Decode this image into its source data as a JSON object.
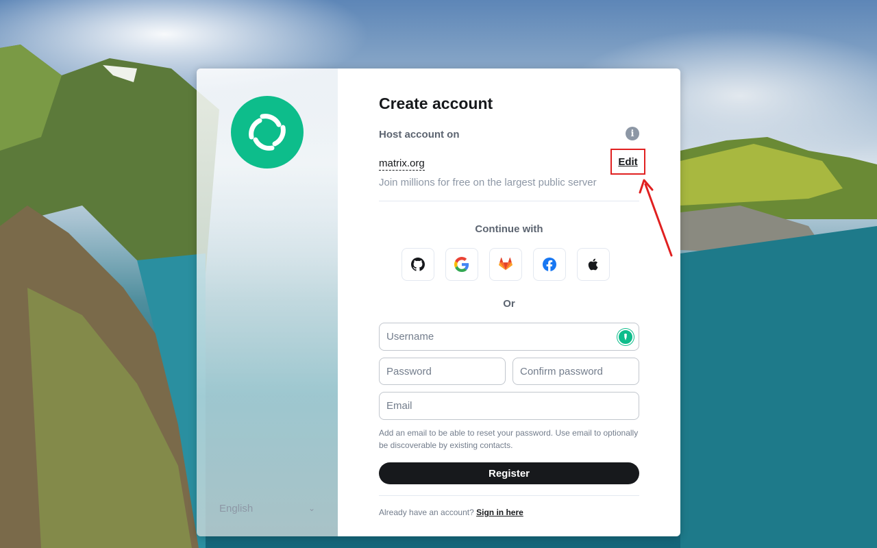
{
  "page": {
    "title": "Create account",
    "accent_color": "#0dbd8b",
    "annotation_color": "#e02020"
  },
  "sidebar": {
    "logo_icon": "element-logo-icon",
    "language": {
      "selected": "English",
      "chevron_icon": "chevron-down-icon"
    }
  },
  "host": {
    "label": "Host account on",
    "info_icon": "info-icon",
    "server": "matrix.org",
    "edit_label": "Edit",
    "description": "Join millions for free on the largest public server"
  },
  "sso": {
    "heading": "Continue with",
    "providers": [
      {
        "name": "GitHub",
        "icon": "github-icon"
      },
      {
        "name": "Google",
        "icon": "google-icon"
      },
      {
        "name": "GitLab",
        "icon": "gitlab-icon"
      },
      {
        "name": "Facebook",
        "icon": "facebook-icon"
      },
      {
        "name": "Apple",
        "icon": "apple-icon"
      }
    ],
    "separator": "Or"
  },
  "form": {
    "username": {
      "placeholder": "Username",
      "value": ""
    },
    "password": {
      "placeholder": "Password",
      "value": ""
    },
    "confirm_password": {
      "placeholder": "Confirm password",
      "value": ""
    },
    "email": {
      "placeholder": "Email",
      "value": ""
    },
    "email_help": "Add an email to be able to reset your password. Use email to optionally be discoverable by existing contacts.",
    "register_label": "Register"
  },
  "footer": {
    "prompt": "Already have an account?",
    "signin_label": "Sign in here"
  }
}
